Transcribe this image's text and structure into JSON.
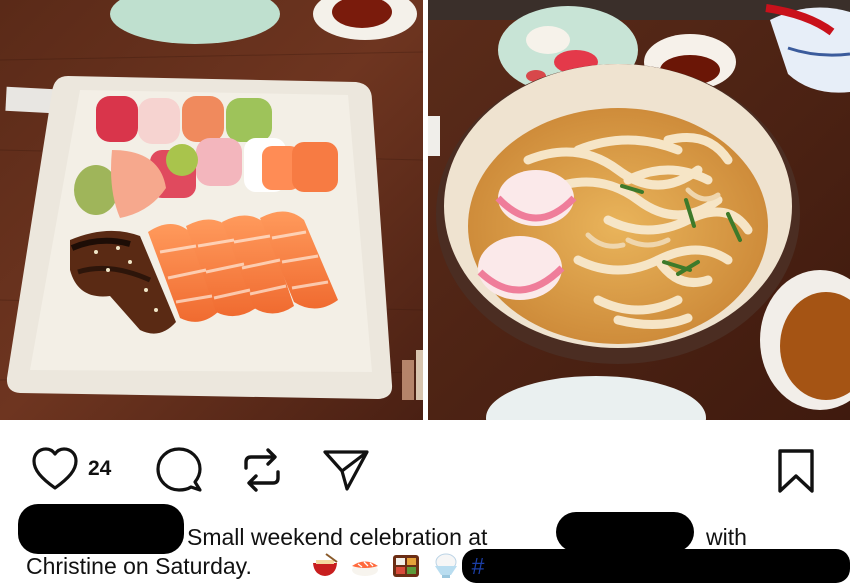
{
  "post": {
    "image_alt_left": "Sushi platter",
    "image_alt_right": "Udon noodle soup"
  },
  "actions": {
    "like_count": "24",
    "icons": [
      "heart-icon",
      "comment-icon",
      "repost-icon",
      "share-icon",
      "bookmark-icon"
    ]
  },
  "caption": {
    "part1": "Small weekend celebration at",
    "part2": "with",
    "part3": "Christine on Saturday.",
    "hashtag_start": "#",
    "emoji": [
      "noodle-bowl-emoji",
      "sushi-emoji",
      "bento-emoji",
      "shaved-ice-emoji"
    ]
  },
  "colors": {
    "text": "#111111",
    "hashtag": "#1c3fa8",
    "redaction": "#000000"
  }
}
